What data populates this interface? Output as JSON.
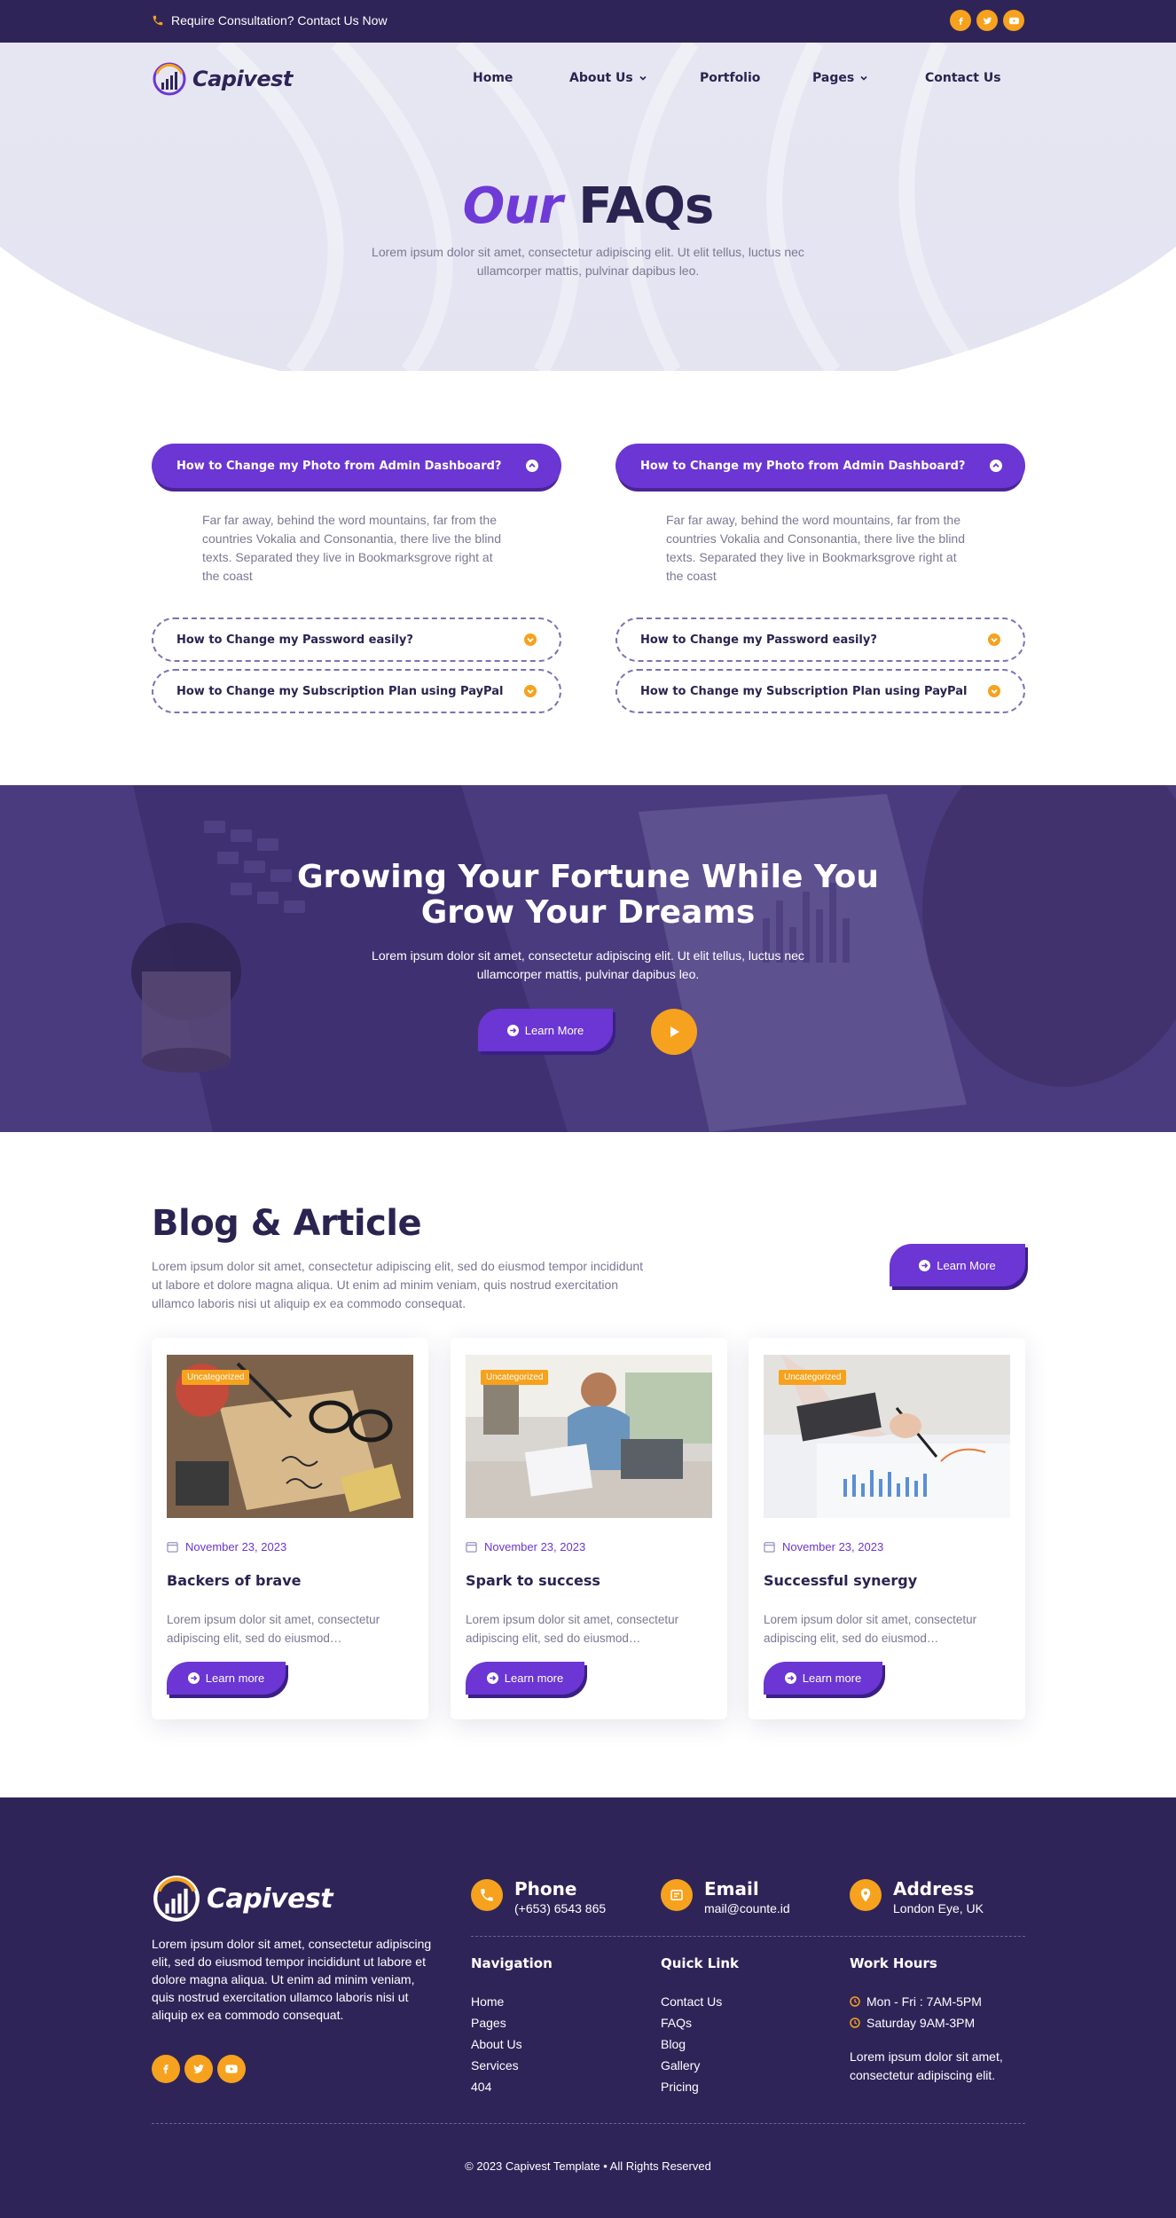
{
  "topbar": {
    "consultation": "Require Consultation? Contact Us Now",
    "social": [
      "facebook-icon",
      "twitter-icon",
      "youtube-icon"
    ]
  },
  "brand": {
    "name": "Capivest"
  },
  "nav": {
    "items": [
      {
        "label": "Home",
        "dropdown": false
      },
      {
        "label": "About Us",
        "dropdown": true
      },
      {
        "label": "Portfolio",
        "dropdown": false
      },
      {
        "label": "Pages",
        "dropdown": true
      },
      {
        "label": "Contact Us",
        "dropdown": false
      }
    ]
  },
  "hero": {
    "title_accent": "Our",
    "title_main": "FAQs",
    "subtitle": "Lorem ipsum dolor sit amet, consectetur adipiscing elit. Ut elit tellus, luctus nec ullamcorper mattis, pulvinar dapibus leo."
  },
  "faq": {
    "columns": [
      {
        "open_question": "How to Change my Photo from Admin Dashboard?",
        "open_answer": "Far far away, behind the word mountains, far from the countries Vokalia and Consonantia, there live the blind texts. Separated they live in Bookmarksgrove right at the coast",
        "closed": [
          "How to Change my Password easily?",
          "How to Change my Subscription Plan using PayPal"
        ]
      },
      {
        "open_question": "How to Change my Photo from Admin Dashboard?",
        "open_answer": "Far far away, behind the word mountains, far from the countries Vokalia and Consonantia, there live the blind texts. Separated they live in Bookmarksgrove right at the coast",
        "closed": [
          "How to Change my Password easily?",
          "How to Change my Subscription Plan using PayPal"
        ]
      }
    ]
  },
  "cta": {
    "title_line1": "Growing Your Fortune While You",
    "title_line2": "Grow Your Dreams",
    "subtitle": "Lorem ipsum dolor sit amet, consectetur adipiscing elit. Ut elit tellus, luctus nec ullamcorper mattis, pulvinar dapibus leo.",
    "button": "Learn More"
  },
  "blog": {
    "title": "Blog & Article",
    "subtitle": "Lorem ipsum dolor sit amet, consectetur adipiscing elit, sed do eiusmod tempor incididunt ut labore et dolore magna aliqua. Ut enim ad minim veniam, quis nostrud exercitation ullamco laboris nisi ut aliquip ex ea commodo consequat.",
    "button": "Learn More",
    "cards": [
      {
        "badge": "Uncategorized",
        "date": "November 23, 2023",
        "title": "Backers of brave",
        "excerpt": "Lorem ipsum dolor sit amet, consectetur adipiscing elit, sed do eiusmod…",
        "button": "Learn more"
      },
      {
        "badge": "Uncategorized",
        "date": "November 23, 2023",
        "title": "Spark to success",
        "excerpt": "Lorem ipsum dolor sit amet, consectetur adipiscing elit, sed do eiusmod…",
        "button": "Learn more"
      },
      {
        "badge": "Uncategorized",
        "date": "November 23, 2023",
        "title": "Successful synergy",
        "excerpt": "Lorem ipsum dolor sit amet, consectetur adipiscing elit, sed do eiusmod…",
        "button": "Learn more"
      }
    ]
  },
  "footer": {
    "about": "Lorem ipsum dolor sit amet, consectetur adipiscing elit, sed do eiusmod tempor incididunt ut labore et dolore magna aliqua. Ut enim ad minim veniam, quis nostrud exercitation ullamco laboris nisi ut aliquip ex ea commodo consequat.",
    "phone": {
      "label": "Phone",
      "value": "(+653) 6543 865"
    },
    "email": {
      "label": "Email",
      "value": "mail@counte.id"
    },
    "address": {
      "label": "Address",
      "value": "London Eye, UK"
    },
    "navigation": {
      "title": "Navigation",
      "links": [
        "Home",
        "Pages",
        "About Us",
        "Services",
        "404"
      ]
    },
    "quick_link": {
      "title": "Quick Link",
      "links": [
        "Contact Us",
        "FAQs",
        "Blog",
        "Gallery",
        "Pricing"
      ]
    },
    "work_hours": {
      "title": "Work Hours",
      "lines": [
        "Mon - Fri : 7AM-5PM",
        "Saturday 9AM-3PM"
      ],
      "note": "Lorem ipsum dolor sit amet, consectetur adipiscing elit."
    },
    "copyright": "© 2023 Capivest Template • All Rights Reserved"
  },
  "colors": {
    "primary": "#6b36d3",
    "dark": "#2f2458",
    "accent": "#f6a21e",
    "text": "#2b2350",
    "muted": "#7b7893"
  }
}
